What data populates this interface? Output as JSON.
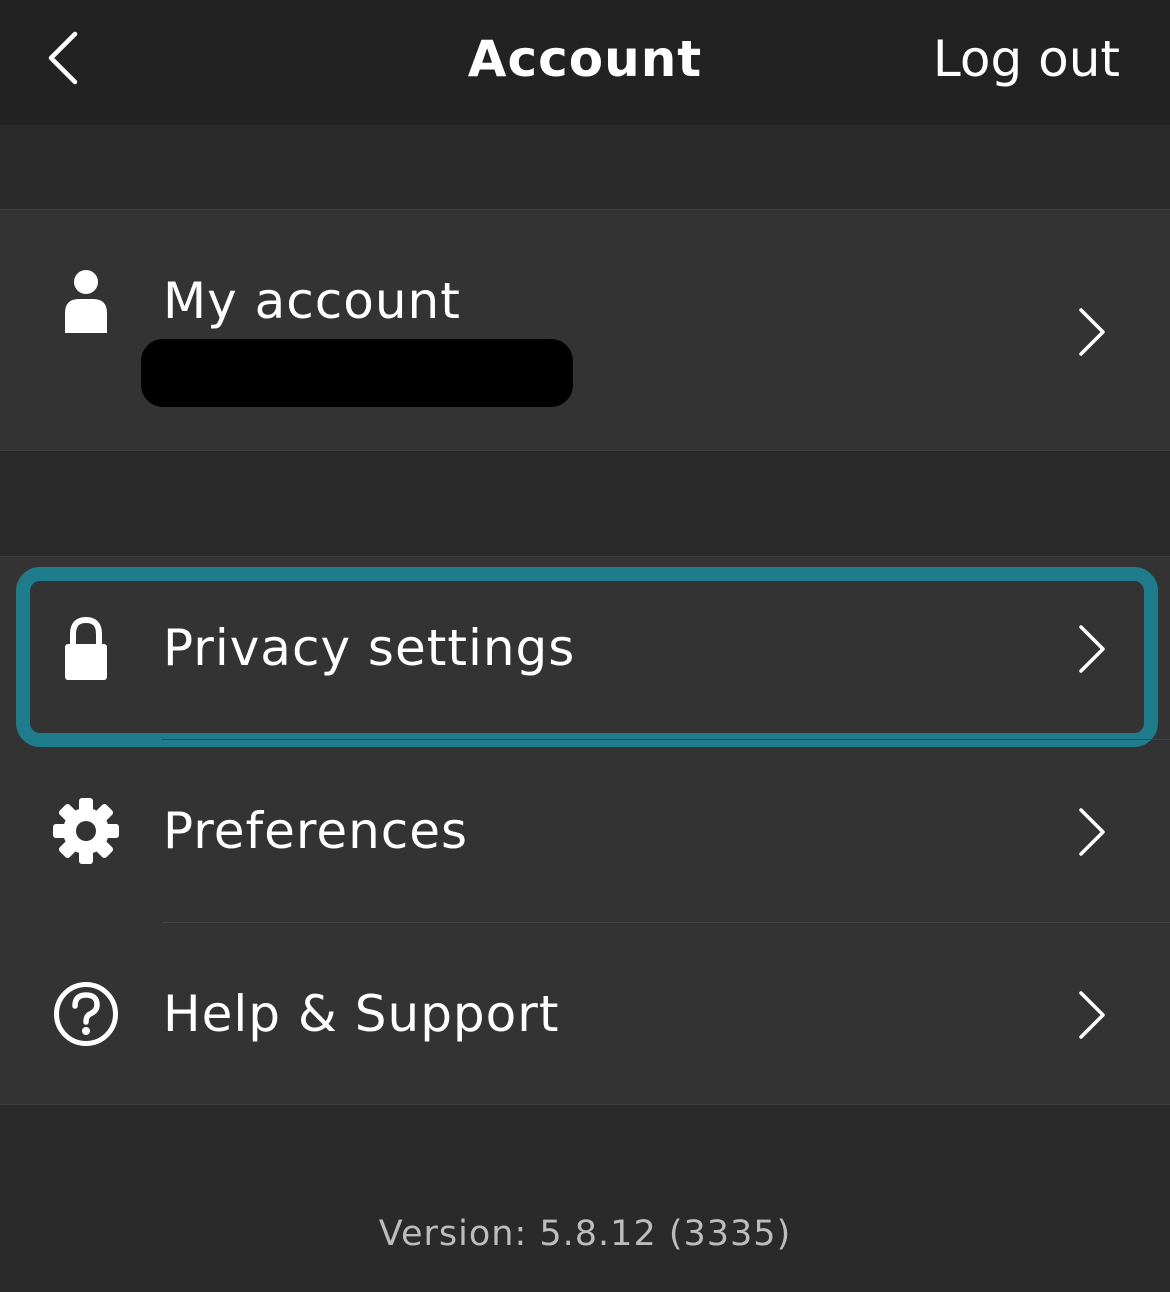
{
  "header": {
    "back_icon": "chevron-left-icon",
    "title": "Account",
    "logout_label": "Log out"
  },
  "account_section": {
    "item": {
      "icon": "person-icon",
      "label": "My account",
      "subtitle_redacted": true,
      "chevron_icon": "chevron-right-icon"
    }
  },
  "settings_section": {
    "items": [
      {
        "icon": "lock-icon",
        "label": "Privacy settings",
        "chevron_icon": "chevron-right-icon",
        "focused": true
      },
      {
        "icon": "gear-icon",
        "label": "Preferences",
        "chevron_icon": "chevron-right-icon"
      },
      {
        "icon": "question-circle-icon",
        "label": "Help & Support",
        "chevron_icon": "chevron-right-icon"
      }
    ]
  },
  "footer": {
    "version_text": "Version: 5.8.12 (3335)"
  },
  "colors": {
    "background": "#2a2a2b",
    "navbar": "#222223",
    "cell": "#333334",
    "focus_ring": "#1f7c8c",
    "text": "#ffffff",
    "secondary_text": "#bdbdbd"
  }
}
